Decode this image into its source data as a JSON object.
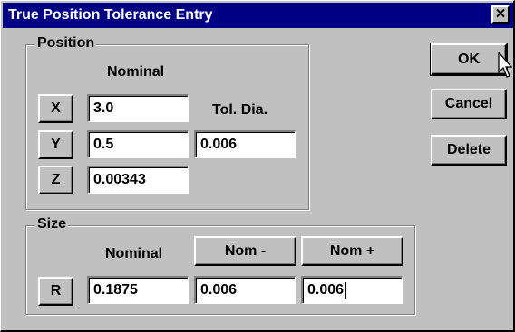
{
  "window": {
    "title": "True Position Tolerance Entry",
    "close_glyph": "✕"
  },
  "position": {
    "group_label": "Position",
    "nominal_header": "Nominal",
    "tol_header": "Tol. Dia.",
    "x": {
      "button": "X",
      "value": "3.0"
    },
    "y": {
      "button": "Y",
      "value": "0.5",
      "tol": "0.006"
    },
    "z": {
      "button": "Z",
      "value": "0.00343"
    }
  },
  "size": {
    "group_label": "Size",
    "nominal_header": "Nominal",
    "nom_minus": "Nom -",
    "nom_plus": "Nom +",
    "r": {
      "button": "R",
      "nominal": "0.1875",
      "minus": "0.006",
      "plus": "0.006"
    }
  },
  "actions": {
    "ok": "OK",
    "cancel": "Cancel",
    "delete": "Delete"
  },
  "icons": {
    "cursor": "arrow-cursor-icon"
  }
}
